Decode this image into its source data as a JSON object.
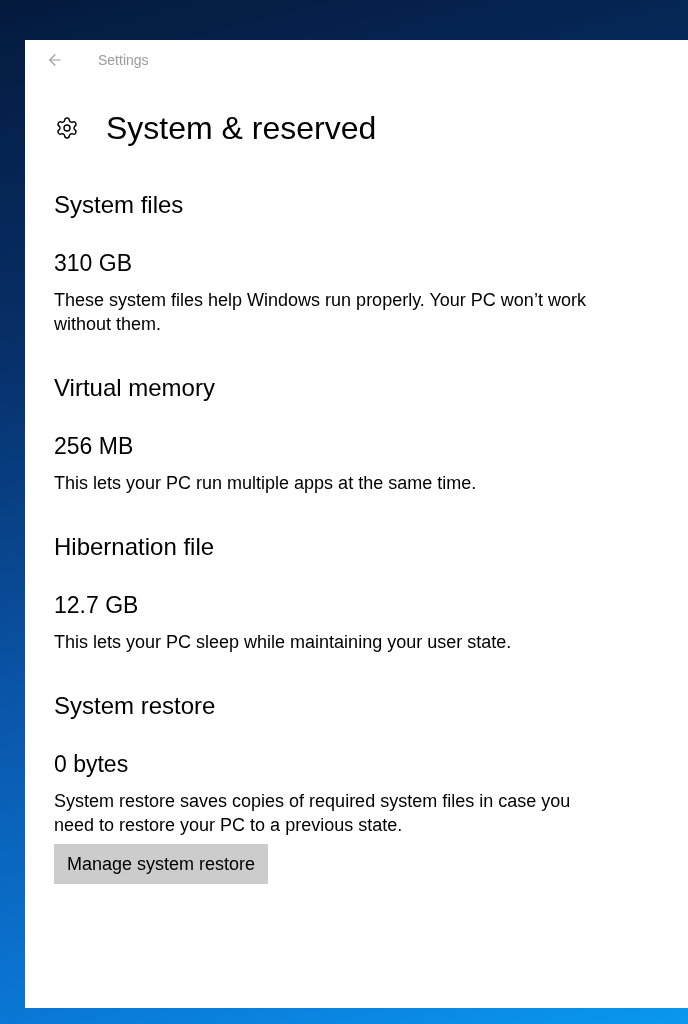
{
  "window": {
    "title": "Settings"
  },
  "page": {
    "title": "System & reserved"
  },
  "sections": [
    {
      "heading": "System files",
      "size": "310 GB",
      "description": "These system files help Windows run properly. Your PC won’t work without them."
    },
    {
      "heading": "Virtual memory",
      "size": "256 MB",
      "description": "This lets your PC run multiple apps at the same time."
    },
    {
      "heading": "Hibernation file",
      "size": "12.7 GB",
      "description": "This lets your PC sleep while maintaining your user state."
    },
    {
      "heading": "System restore",
      "size": "0 bytes",
      "description": "System restore saves copies of required system files in case you need to restore your PC to a previous state.",
      "button": {
        "label": "Manage system restore"
      }
    }
  ]
}
